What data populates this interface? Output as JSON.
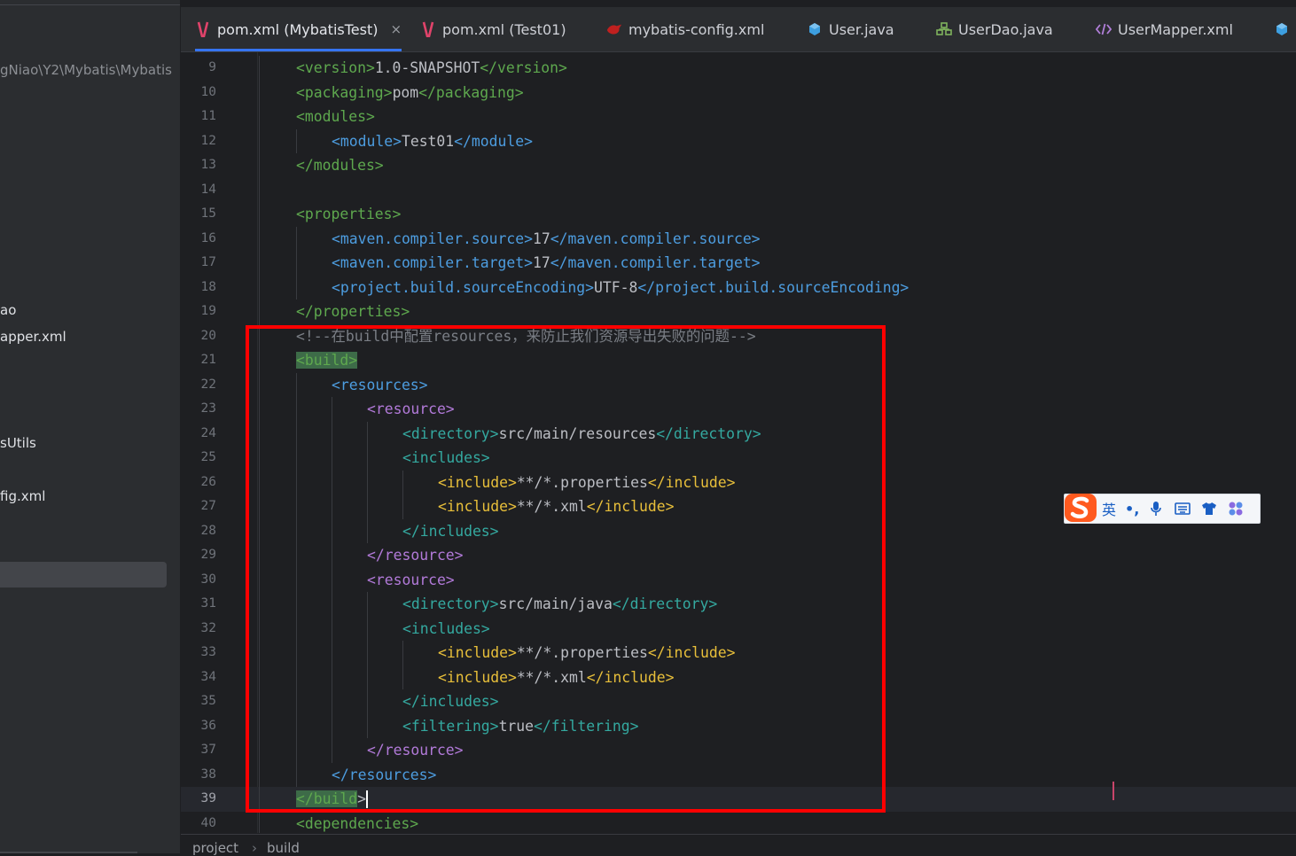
{
  "sidebar": {
    "path_text": "gNiao\\Y2\\Mybatis\\Mybatis",
    "items": [
      {
        "label": "ao"
      },
      {
        "label": "apper.xml"
      },
      {
        "label": "sUtils"
      },
      {
        "label": "fig.xml"
      }
    ]
  },
  "tabs": [
    {
      "label": "pom.xml (MybatisTest)",
      "icon": "maven-icon",
      "active": true,
      "close": "×"
    },
    {
      "label": "pom.xml (Test01)",
      "icon": "maven-icon"
    },
    {
      "label": "mybatis-config.xml",
      "icon": "mybatis-bird-icon"
    },
    {
      "label": "User.java",
      "icon": "java-class-icon"
    },
    {
      "label": "UserDao.java",
      "icon": "interface-icon"
    },
    {
      "label": "UserMapper.xml",
      "icon": "xml-code-icon"
    }
  ],
  "editor": {
    "current_line": "39",
    "lines": [
      {
        "n": "9",
        "ind": 1,
        "p": [
          [
            "<version>",
            "t-d"
          ],
          [
            "1.0-SNAPSHOT",
            "tx"
          ],
          [
            "</version>",
            "t-d"
          ]
        ]
      },
      {
        "n": "10",
        "ind": 1,
        "p": [
          [
            "<packaging>",
            "t-d"
          ],
          [
            "pom",
            "tx"
          ],
          [
            "</packaging>",
            "t-d"
          ]
        ]
      },
      {
        "n": "11",
        "ind": 1,
        "p": [
          [
            "<modules>",
            "t-d"
          ]
        ]
      },
      {
        "n": "12",
        "ind": 2,
        "p": [
          [
            "<module>",
            "t-b"
          ],
          [
            "Test01",
            "tx"
          ],
          [
            "</module>",
            "t-b"
          ]
        ]
      },
      {
        "n": "13",
        "ind": 1,
        "p": [
          [
            "</modules>",
            "t-d"
          ]
        ]
      },
      {
        "n": "14",
        "ind": 1,
        "p": []
      },
      {
        "n": "15",
        "ind": 1,
        "p": [
          [
            "<properties>",
            "t-d"
          ]
        ]
      },
      {
        "n": "16",
        "ind": 2,
        "p": [
          [
            "<maven.compiler.source>",
            "t-b"
          ],
          [
            "17",
            "tx"
          ],
          [
            "</maven.compiler.source>",
            "t-b"
          ]
        ]
      },
      {
        "n": "17",
        "ind": 2,
        "p": [
          [
            "<maven.compiler.target>",
            "t-b"
          ],
          [
            "17",
            "tx"
          ],
          [
            "</maven.compiler.target>",
            "t-b"
          ]
        ]
      },
      {
        "n": "18",
        "ind": 2,
        "p": [
          [
            "<project.build.sourceEncoding>",
            "t-b"
          ],
          [
            "UTF-8",
            "tx"
          ],
          [
            "</project.build.sourceEncoding>",
            "t-b"
          ]
        ]
      },
      {
        "n": "19",
        "ind": 1,
        "p": [
          [
            "</properties>",
            "t-d"
          ]
        ]
      },
      {
        "n": "20",
        "ind": 1,
        "p": [
          [
            "<!--在build中配置resources，来防止我们资源导出失败的问题-->",
            "cm"
          ]
        ]
      },
      {
        "n": "21",
        "ind": 1,
        "p": [
          [
            "<",
            "t-d hl"
          ],
          [
            "build>",
            "t-d hl"
          ]
        ]
      },
      {
        "n": "22",
        "ind": 2,
        "p": [
          [
            "<resources>",
            "t-b"
          ]
        ]
      },
      {
        "n": "23",
        "ind": 3,
        "p": [
          [
            "<resource>",
            "t-p"
          ]
        ]
      },
      {
        "n": "24",
        "ind": 4,
        "p": [
          [
            "<directory>",
            "t-c"
          ],
          [
            "src/main/resources",
            "tx"
          ],
          [
            "</directory>",
            "t-c"
          ]
        ]
      },
      {
        "n": "25",
        "ind": 4,
        "p": [
          [
            "<includes>",
            "t-c"
          ]
        ]
      },
      {
        "n": "26",
        "ind": 5,
        "p": [
          [
            "<include>",
            "t-y"
          ],
          [
            "**/*.properties",
            "tx"
          ],
          [
            "</include>",
            "t-y"
          ]
        ]
      },
      {
        "n": "27",
        "ind": 5,
        "p": [
          [
            "<include>",
            "t-y"
          ],
          [
            "**/*.xml",
            "tx"
          ],
          [
            "</include>",
            "t-y"
          ]
        ]
      },
      {
        "n": "28",
        "ind": 4,
        "p": [
          [
            "</includes>",
            "t-c"
          ]
        ]
      },
      {
        "n": "29",
        "ind": 3,
        "p": [
          [
            "</resource>",
            "t-p"
          ]
        ]
      },
      {
        "n": "30",
        "ind": 3,
        "p": [
          [
            "<resource>",
            "t-p"
          ]
        ]
      },
      {
        "n": "31",
        "ind": 4,
        "p": [
          [
            "<directory>",
            "t-c"
          ],
          [
            "src/main/java",
            "tx"
          ],
          [
            "</directory>",
            "t-c"
          ]
        ]
      },
      {
        "n": "32",
        "ind": 4,
        "p": [
          [
            "<includes>",
            "t-c"
          ]
        ]
      },
      {
        "n": "33",
        "ind": 5,
        "p": [
          [
            "<include>",
            "t-y"
          ],
          [
            "**/*.properties",
            "tx"
          ],
          [
            "</include>",
            "t-y"
          ]
        ]
      },
      {
        "n": "34",
        "ind": 5,
        "p": [
          [
            "<include>",
            "t-y"
          ],
          [
            "**/*.xml",
            "tx"
          ],
          [
            "</include>",
            "t-y"
          ]
        ]
      },
      {
        "n": "35",
        "ind": 4,
        "p": [
          [
            "</includes>",
            "t-c"
          ]
        ]
      },
      {
        "n": "36",
        "ind": 4,
        "p": [
          [
            "<filtering>",
            "t-c"
          ],
          [
            "true",
            "tx"
          ],
          [
            "</filtering>",
            "t-c"
          ]
        ]
      },
      {
        "n": "37",
        "ind": 3,
        "p": [
          [
            "</resource>",
            "t-p"
          ]
        ]
      },
      {
        "n": "38",
        "ind": 2,
        "p": [
          [
            "</resources>",
            "t-b"
          ]
        ]
      },
      {
        "n": "39",
        "ind": 1,
        "p": [
          [
            "</build",
            "t-d hl"
          ],
          [
            ">",
            "tx"
          ]
        ]
      },
      {
        "n": "40",
        "ind": 1,
        "p": [
          [
            "<dependencies>",
            "t-d"
          ]
        ]
      }
    ]
  },
  "ime": {
    "label": "英",
    "punct": "•,"
  },
  "breadcrumb": {
    "items": [
      "project",
      "build"
    ],
    "sep": "›"
  }
}
